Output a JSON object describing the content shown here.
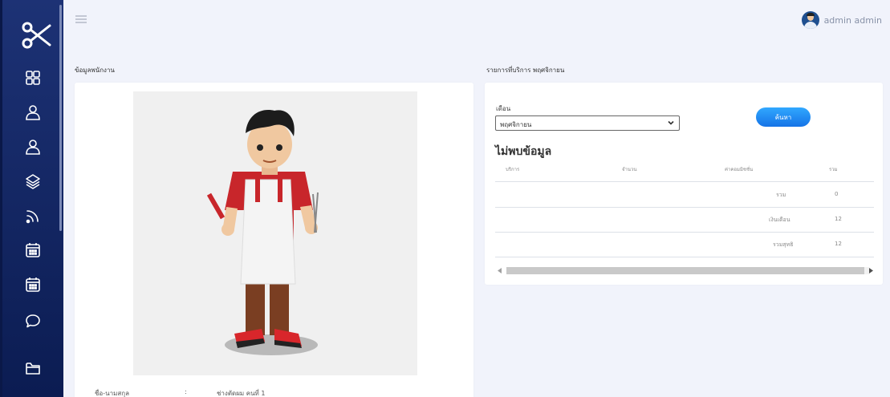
{
  "sidebar": {
    "logo_icon": "scissors-icon",
    "items": [
      {
        "icon": "dashboard-grid-icon"
      },
      {
        "icon": "user-icon"
      },
      {
        "icon": "user-icon"
      },
      {
        "icon": "layers-icon"
      },
      {
        "icon": "rss-feed-icon"
      },
      {
        "icon": "calendar-icon"
      },
      {
        "icon": "calendar-icon"
      },
      {
        "icon": "chat-bubble-icon"
      },
      {
        "icon": "folder-icon"
      }
    ]
  },
  "topbar": {
    "menu_icon": "hamburger-menu-icon",
    "user_name": "admin admin"
  },
  "employee": {
    "section_title": "ข้อมูลพนักงาน",
    "name_label": "ชื่อ-นามสกุล",
    "separator": ":",
    "name_value": "ช่างตัดผม คนที่ 1"
  },
  "report": {
    "section_title": "รายการที่บริการ พฤศจิกายน",
    "month_label": "เดือน",
    "month_selected": "พฤศจิกายน",
    "search_button": "ค้นหา",
    "no_data": "ไม่พบข้อมูล",
    "columns": [
      "บริการ",
      "จำนวน",
      "ค่าคอมมิชชั่น",
      "รวม"
    ],
    "summary": [
      {
        "label": "รวม",
        "value": "0"
      },
      {
        "label": "เงินเดือน",
        "value": "12"
      },
      {
        "label": "รวมสุทธิ",
        "value": "12"
      }
    ]
  },
  "colors": {
    "sidebar": "#1d3275",
    "accent": "#1f8cf5",
    "background": "#f1f3fb"
  }
}
